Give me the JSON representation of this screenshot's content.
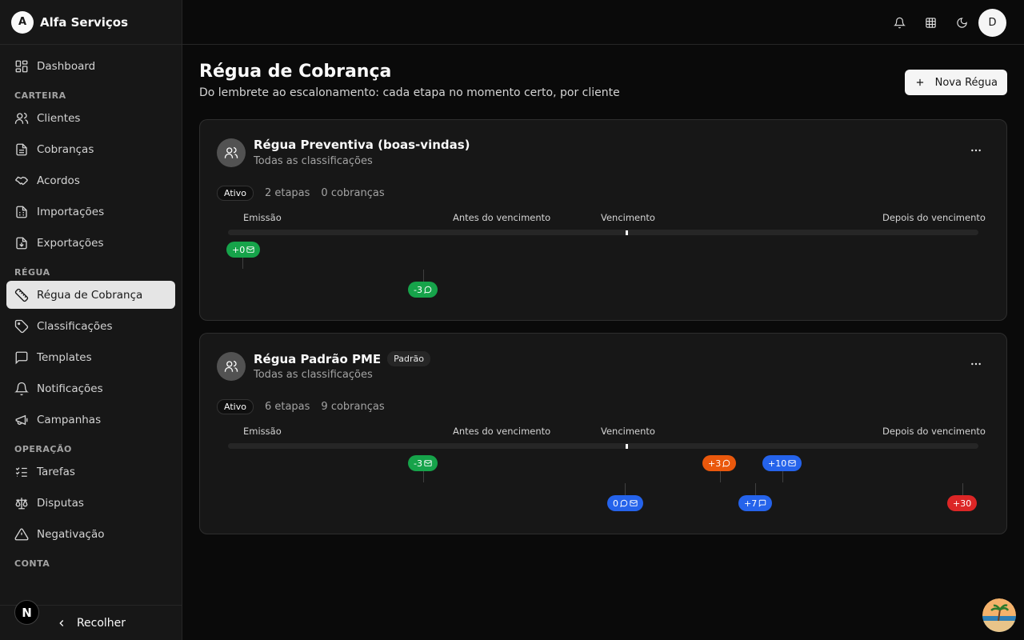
{
  "app": {
    "initial": "A",
    "name": "Alfa Serviços"
  },
  "sidebar": {
    "dashboard": "Dashboard",
    "sections": {
      "carteira": "CARTEIRA",
      "regua": "RÉGUA",
      "operacao": "OPERAÇÃO",
      "conta": "CONTA"
    },
    "items": {
      "clientes": "Clientes",
      "cobrancas": "Cobranças",
      "acordos": "Acordos",
      "importacoes": "Importações",
      "exportacoes": "Exportações",
      "regua_cobranca": "Régua de Cobrança",
      "classificacoes": "Classificações",
      "templates": "Templates",
      "notificacoes": "Notificações",
      "campanhas": "Campanhas",
      "tarefas": "Tarefas",
      "disputas": "Disputas",
      "negativacao": "Negativação"
    },
    "collapse_label": "Recolher",
    "n_badge": "N"
  },
  "header": {
    "user_initial": "D"
  },
  "page": {
    "title": "Régua de Cobrança",
    "subtitle": "Do lembrete ao escalonamento: cada etapa no momento certo, por cliente",
    "new_button": "Nova Régua"
  },
  "timeline_labels": {
    "emissao": "Emissão",
    "antes": "Antes do vencimento",
    "vencimento": "Vencimento",
    "depois": "Depois do vencimento"
  },
  "reguas": [
    {
      "title": "Régua Preventiva (boas-vindas)",
      "subtitle": "Todas as classificações",
      "status": "Ativo",
      "etapas": "2 etapas",
      "cobrancas": "0 cobranças",
      "steps": [
        {
          "label": "+0",
          "channels": [
            "email-icon"
          ],
          "color": "#16a34a"
        },
        {
          "label": "-3",
          "channels": [
            "chat-icon"
          ],
          "color": "#16a34a"
        }
      ]
    },
    {
      "title": "Régua Padrão PME",
      "badge": "Padrão",
      "subtitle": "Todas as classificações",
      "status": "Ativo",
      "etapas": "6 etapas",
      "cobrancas": "9 cobranças",
      "steps": [
        {
          "label": "-3",
          "channels": [
            "email-icon"
          ],
          "color": "#16a34a"
        },
        {
          "label": "0",
          "channels": [
            "chat-icon",
            "email-icon"
          ],
          "color": "#2563eb"
        },
        {
          "label": "+3",
          "channels": [
            "chat-icon"
          ],
          "color": "#ea580c"
        },
        {
          "label": "+7",
          "channels": [
            "message-icon"
          ],
          "color": "#2563eb"
        },
        {
          "label": "+10",
          "channels": [
            "email-icon"
          ],
          "color": "#2563eb"
        },
        {
          "label": "+30",
          "channels": [],
          "color": "#dc2626"
        }
      ]
    }
  ]
}
